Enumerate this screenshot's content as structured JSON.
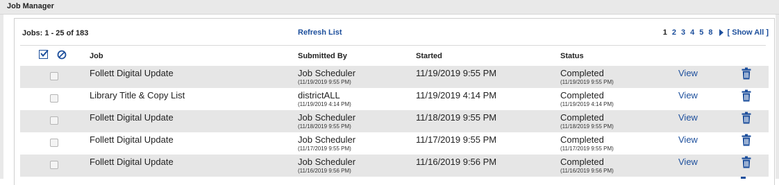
{
  "header": {
    "title": "Job Manager"
  },
  "toolbar": {
    "jobs_count": "Jobs: 1 - 25 of 183",
    "refresh_label": "Refresh List",
    "pages": [
      "1",
      "2",
      "3",
      "4",
      "5",
      "8"
    ],
    "current_page": "1",
    "show_all_label": "[ Show All ]"
  },
  "columns": {
    "job": "Job",
    "submitted_by": "Submitted By",
    "started": "Started",
    "status": "Status"
  },
  "rows": [
    {
      "job": "Follett Digital Update",
      "submitted_by": "Job Scheduler",
      "submitted_time": "(11/19/2019 9:55 PM)",
      "started": "11/19/2019 9:55 PM",
      "status": "Completed",
      "status_time": "(11/19/2019 9:55 PM)",
      "view_label": "View"
    },
    {
      "job": "Library Title & Copy List",
      "submitted_by": "districtALL",
      "submitted_time": "(11/19/2019 4:14 PM)",
      "started": "11/19/2019 4:14 PM",
      "status": "Completed",
      "status_time": "(11/19/2019 4:14 PM)",
      "view_label": "View"
    },
    {
      "job": "Follett Digital Update",
      "submitted_by": "Job Scheduler",
      "submitted_time": "(11/18/2019 9:55 PM)",
      "started": "11/18/2019 9:55 PM",
      "status": "Completed",
      "status_time": "(11/18/2019 9:55 PM)",
      "view_label": "View"
    },
    {
      "job": "Follett Digital Update",
      "submitted_by": "Job Scheduler",
      "submitted_time": "(11/17/2019 9:55 PM)",
      "started": "11/17/2019 9:55 PM",
      "status": "Completed",
      "status_time": "(11/17/2019 9:55 PM)",
      "view_label": "View"
    },
    {
      "job": "Follett Digital Update",
      "submitted_by": "Job Scheduler",
      "submitted_time": "(11/16/2019 9:56 PM)",
      "started": "11/16/2019 9:56 PM",
      "status": "Completed",
      "status_time": "(11/16/2019 9:56 PM)",
      "view_label": "View"
    }
  ],
  "icons": {
    "select_all": "check-all-icon",
    "deselect_all": "deselect-all-icon",
    "delete": "trash-icon",
    "next_page": "next-page-arrow-icon"
  },
  "colors": {
    "link": "#1d4f9c",
    "row_shade": "#e6e6e6",
    "header_bar": "#e9e9e9"
  }
}
